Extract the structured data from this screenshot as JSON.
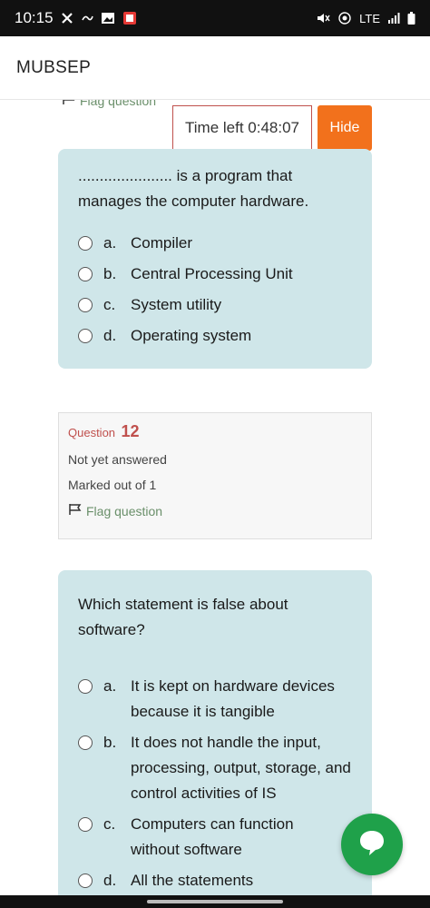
{
  "status_bar": {
    "time": "10:15",
    "network": "LTE"
  },
  "app": {
    "title": "MUBSEP"
  },
  "timer": {
    "text": "Time left 0:48:07",
    "hide_label": "Hide"
  },
  "prev_flag": {
    "label": "Flag question"
  },
  "question11": {
    "text_blank": "......................",
    "text_rest": " is a program that manages the computer hardware.",
    "options": [
      {
        "letter": "a.",
        "text": "Compiler"
      },
      {
        "letter": "b.",
        "text": "Central Processing Unit"
      },
      {
        "letter": "c.",
        "text": "System utility"
      },
      {
        "letter": "d.",
        "text": "Operating system"
      }
    ]
  },
  "question12_info": {
    "label": "Question",
    "number": "12",
    "status": "Not yet answered",
    "marks": "Marked out of 1",
    "flag_label": "Flag question"
  },
  "question12": {
    "text": "Which statement is false about software?",
    "options": [
      {
        "letter": "a.",
        "text": "It is kept on hardware devices because it is tangible"
      },
      {
        "letter": "b.",
        "text": "It does not handle the input, processing, output, storage, and control activities of IS"
      },
      {
        "letter": "c.",
        "text": "Computers can function without software"
      },
      {
        "letter": "d.",
        "text": "All the statements"
      }
    ]
  },
  "colors": {
    "accent": "#f2711c",
    "card_bg": "#cfe6e9",
    "question_label": "#c0504d",
    "chat_button": "#1fa14a"
  }
}
